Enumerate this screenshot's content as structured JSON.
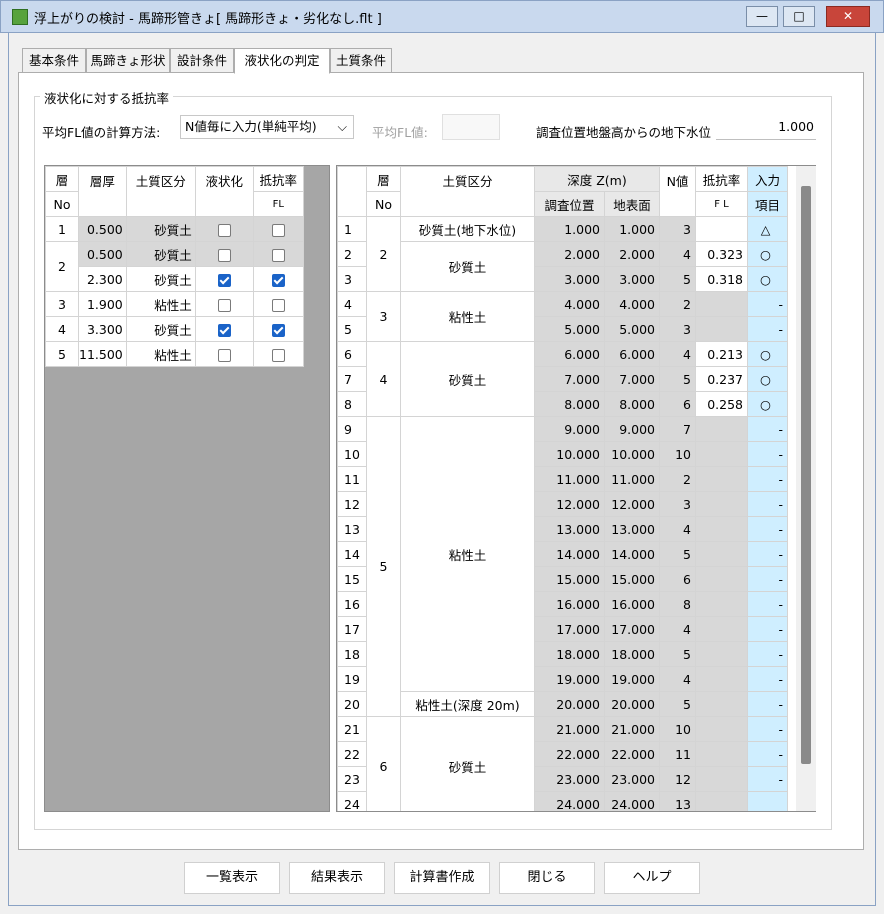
{
  "window": {
    "title": "浮上がりの検討 - 馬蹄形管きょ[ 馬蹄形きょ・劣化なし.flt ]",
    "controls": {
      "minimize": "—",
      "maximize": "□",
      "close": "✕"
    }
  },
  "tabs": [
    {
      "label": "基本条件"
    },
    {
      "label": "馬蹄きょ形状"
    },
    {
      "label": "設計条件"
    },
    {
      "label": "液状化の判定"
    },
    {
      "label": "土質条件"
    }
  ],
  "group": {
    "title": "液状化に対する抵抗率"
  },
  "calc": {
    "label": "平均FL値の計算方法:",
    "selected": "N値毎に入力(単純平均)",
    "arrow": "⌵"
  },
  "fl_avg": {
    "label": "平均FL値:"
  },
  "groundwater": {
    "label": "調査位置地盤高からの地下水位",
    "value": "1.000"
  },
  "left_table": {
    "headers": {
      "layer": "層",
      "layer2": "No",
      "thick": "層厚",
      "soil": "土質区分",
      "liq": "液状化",
      "fl": "抵抗率",
      "fl2": "FL"
    },
    "rows": [
      {
        "no": "1",
        "thick": "0.500",
        "soil": "砂質土",
        "liq": false,
        "fl": false
      },
      {
        "no": "2",
        "thick": "0.500",
        "soil": "砂質土",
        "liq": false,
        "fl": false
      },
      {
        "no": "",
        "thick": "2.300",
        "soil": "砂質土",
        "liq": true,
        "fl": true
      },
      {
        "no": "3",
        "thick": "1.900",
        "soil": "粘性土",
        "liq": false,
        "fl": false
      },
      {
        "no": "4",
        "thick": "3.300",
        "soil": "砂質土",
        "liq": true,
        "fl": true
      },
      {
        "no": "5",
        "thick": "11.500",
        "soil": "粘性土",
        "liq": false,
        "fl": false
      }
    ]
  },
  "right_table": {
    "headers": {
      "layer": "層",
      "layer2": "No",
      "soil": "土質区分",
      "depth": "深度 Z(m)",
      "depth_survey": "調査位置",
      "depth_surface": "地表面",
      "n": "N値",
      "fl": "抵抗率",
      "fl2": "F L",
      "input": "入力",
      "input2": "項目"
    },
    "layers": [
      {
        "no": "2",
        "rows": 1,
        "soils": [
          {
            "label": "砂質土(地下水位)",
            "rows": 1
          },
          {
            "label": "砂質土",
            "rows": 2
          }
        ],
        "span": 3
      },
      {
        "no": "3",
        "soils": [
          {
            "label": "粘性土",
            "rows": 2
          }
        ],
        "span": 2
      },
      {
        "no": "4",
        "soils": [
          {
            "label": "砂質土",
            "rows": 3
          }
        ],
        "span": 3
      },
      {
        "no": "5",
        "soils": [
          {
            "label": "粘性土",
            "rows": 11
          },
          {
            "label": "粘性土(深度 20m)",
            "rows": 1
          }
        ],
        "span": 12
      },
      {
        "no": "6",
        "soils": [
          {
            "label": "砂質土",
            "rows": 4
          }
        ],
        "span": 4
      }
    ],
    "rows": [
      {
        "n": "1",
        "d1": "1.000",
        "d2": "1.000",
        "nv": "3",
        "fl": "",
        "inp": "△"
      },
      {
        "n": "2",
        "d1": "2.000",
        "d2": "2.000",
        "nv": "4",
        "fl": "0.323",
        "inp": "○"
      },
      {
        "n": "3",
        "d1": "3.000",
        "d2": "3.000",
        "nv": "5",
        "fl": "0.318",
        "inp": "○"
      },
      {
        "n": "4",
        "d1": "4.000",
        "d2": "4.000",
        "nv": "2",
        "fl": "",
        "inp": "-"
      },
      {
        "n": "5",
        "d1": "5.000",
        "d2": "5.000",
        "nv": "3",
        "fl": "",
        "inp": "-"
      },
      {
        "n": "6",
        "d1": "6.000",
        "d2": "6.000",
        "nv": "4",
        "fl": "0.213",
        "inp": "○"
      },
      {
        "n": "7",
        "d1": "7.000",
        "d2": "7.000",
        "nv": "5",
        "fl": "0.237",
        "inp": "○"
      },
      {
        "n": "8",
        "d1": "8.000",
        "d2": "8.000",
        "nv": "6",
        "fl": "0.258",
        "inp": "○"
      },
      {
        "n": "9",
        "d1": "9.000",
        "d2": "9.000",
        "nv": "7",
        "fl": "",
        "inp": "-"
      },
      {
        "n": "10",
        "d1": "10.000",
        "d2": "10.000",
        "nv": "10",
        "fl": "",
        "inp": "-"
      },
      {
        "n": "11",
        "d1": "11.000",
        "d2": "11.000",
        "nv": "2",
        "fl": "",
        "inp": "-"
      },
      {
        "n": "12",
        "d1": "12.000",
        "d2": "12.000",
        "nv": "3",
        "fl": "",
        "inp": "-"
      },
      {
        "n": "13",
        "d1": "13.000",
        "d2": "13.000",
        "nv": "4",
        "fl": "",
        "inp": "-"
      },
      {
        "n": "14",
        "d1": "14.000",
        "d2": "14.000",
        "nv": "5",
        "fl": "",
        "inp": "-"
      },
      {
        "n": "15",
        "d1": "15.000",
        "d2": "15.000",
        "nv": "6",
        "fl": "",
        "inp": "-"
      },
      {
        "n": "16",
        "d1": "16.000",
        "d2": "16.000",
        "nv": "8",
        "fl": "",
        "inp": "-"
      },
      {
        "n": "17",
        "d1": "17.000",
        "d2": "17.000",
        "nv": "4",
        "fl": "",
        "inp": "-"
      },
      {
        "n": "18",
        "d1": "18.000",
        "d2": "18.000",
        "nv": "5",
        "fl": "",
        "inp": "-"
      },
      {
        "n": "19",
        "d1": "19.000",
        "d2": "19.000",
        "nv": "4",
        "fl": "",
        "inp": "-"
      },
      {
        "n": "20",
        "d1": "20.000",
        "d2": "20.000",
        "nv": "5",
        "fl": "",
        "inp": "-"
      },
      {
        "n": "21",
        "d1": "21.000",
        "d2": "21.000",
        "nv": "10",
        "fl": "",
        "inp": "-"
      },
      {
        "n": "22",
        "d1": "22.000",
        "d2": "22.000",
        "nv": "11",
        "fl": "",
        "inp": "-"
      },
      {
        "n": "23",
        "d1": "23.000",
        "d2": "23.000",
        "nv": "12",
        "fl": "",
        "inp": "-"
      },
      {
        "n": "24",
        "d1": "24.000",
        "d2": "24.000",
        "nv": "13",
        "fl": "",
        "inp": ""
      }
    ]
  },
  "buttons": [
    {
      "label": "一覧表示"
    },
    {
      "label": "結果表示"
    },
    {
      "label": "計算書作成"
    },
    {
      "label": "閉じる"
    },
    {
      "label": "ヘルプ"
    }
  ]
}
